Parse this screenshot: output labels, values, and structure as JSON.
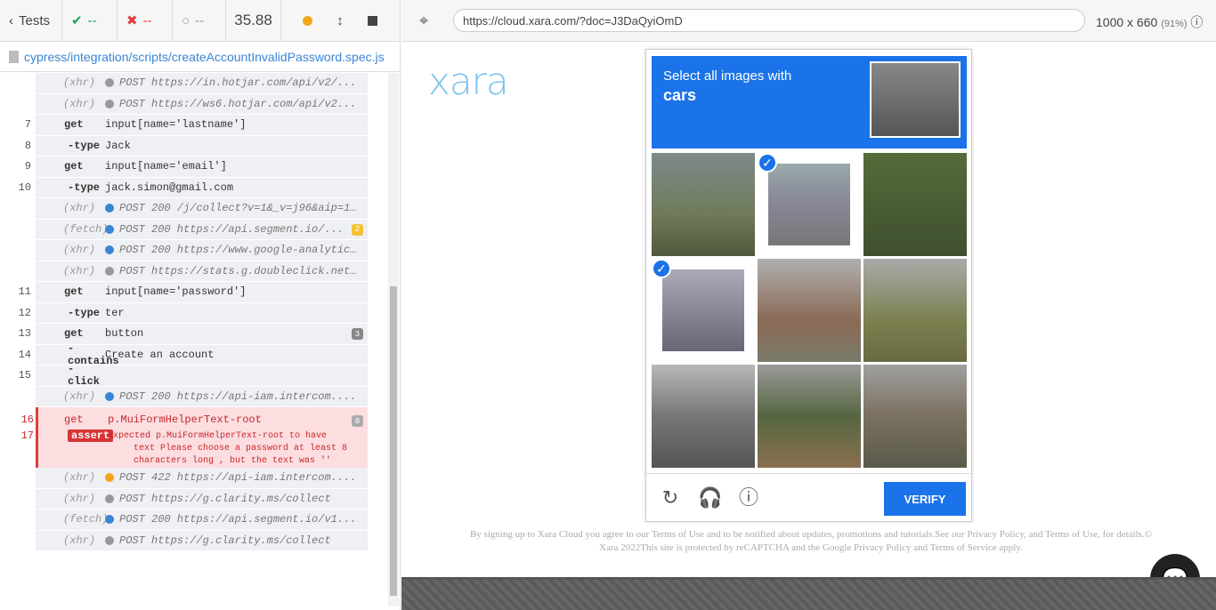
{
  "runner": {
    "tests_label": "Tests",
    "passed": "--",
    "failed": "--",
    "pending": "--",
    "duration": "35.88",
    "spec_path": "cypress/integration/scripts/createAccountInvalidPassword.spec.js"
  },
  "log": [
    {
      "num": "",
      "cmd": "(xhr)",
      "kind": "sub",
      "dot": "#999",
      "val": "POST https://in.hotjar.com/api/v2/..."
    },
    {
      "num": "",
      "cmd": "(xhr)",
      "kind": "sub",
      "dot": "#999",
      "val": "POST https://ws6.hotjar.com/api/v2..."
    },
    {
      "num": "7",
      "cmd": "get",
      "kind": "cmd",
      "val": "input[name='lastname']"
    },
    {
      "num": "8",
      "cmd": "-type",
      "kind": "child",
      "val": "Jack"
    },
    {
      "num": "9",
      "cmd": "get",
      "kind": "cmd",
      "val": "input[name='email']"
    },
    {
      "num": "10",
      "cmd": "-type",
      "kind": "child",
      "val": "jack.simon@gmail.com"
    },
    {
      "num": "",
      "cmd": "(xhr)",
      "kind": "sub",
      "dot": "#3a85d6",
      "val": "POST 200 /j/collect?v=1&_v=j96&aip=1&a=83..."
    },
    {
      "num": "",
      "cmd": "(fetch)",
      "kind": "sub",
      "dot": "#3a85d6",
      "val": "POST 200 https://api.segment.io/...",
      "badge": "2",
      "badgecolor": "y"
    },
    {
      "num": "",
      "cmd": "(xhr)",
      "kind": "sub",
      "dot": "#3a85d6",
      "val": "POST 200 https://www.google-analytics.com..."
    },
    {
      "num": "",
      "cmd": "(xhr)",
      "kind": "sub",
      "dot": "#999",
      "val": "POST https://stats.g.doubleclick.net/j/co..."
    },
    {
      "num": "11",
      "cmd": "get",
      "kind": "cmd",
      "val": "input[name='password']"
    },
    {
      "num": "12",
      "cmd": "-type",
      "kind": "child",
      "val": "ter"
    },
    {
      "num": "13",
      "cmd": "get",
      "kind": "cmd",
      "val": "button",
      "badge": "3"
    },
    {
      "num": "14",
      "cmd": "-contains",
      "kind": "child",
      "val": "Create an account"
    },
    {
      "num": "15",
      "cmd": "-click",
      "kind": "child",
      "val": ""
    },
    {
      "num": "",
      "cmd": "(xhr)",
      "kind": "sub",
      "dot": "#3a85d6",
      "val": "POST 200 https://api-iam.intercom...."
    }
  ],
  "failure": {
    "num1": "16",
    "cmd1": "get",
    "val1": "p.MuiFormHelperText-root",
    "badge": "0",
    "num2": "17",
    "assert": "assert",
    "line1": "expected p.MuiFormHelperText-root to have",
    "line2": "text Please choose a password at least 8",
    "line3": "characters long , but the text was ''"
  },
  "log_after": [
    {
      "cmd": "(xhr)",
      "dot": "#f4a51c",
      "val": "POST 422 https://api-iam.intercom...."
    },
    {
      "cmd": "(xhr)",
      "dot": "#999",
      "val": "POST https://g.clarity.ms/collect"
    },
    {
      "cmd": "(fetch)",
      "dot": "#3a85d6",
      "val": "POST 200 https://api.segment.io/v1..."
    },
    {
      "cmd": "(xhr)",
      "dot": "#999",
      "val": "POST https://g.clarity.ms/collect"
    }
  ],
  "browser": {
    "url": "https://cloud.xara.com/?doc=J3DaQyiOmD",
    "size": "1000 x 660",
    "zoom": "(91%)"
  },
  "app": {
    "logo": "xara",
    "footer_text": "By signing up to Xara Cloud you agree to our Terms of Use and to be notified about updates, promotions and tutorials.See our Privacy Policy, and Terms of Use, for details.© Xara 2022This site is protected by reCAPTCHA and the Google Privacy Policy and Terms of Service apply."
  },
  "captcha": {
    "line1": "Select all images with",
    "line2": "cars",
    "verify": "VERIFY"
  }
}
